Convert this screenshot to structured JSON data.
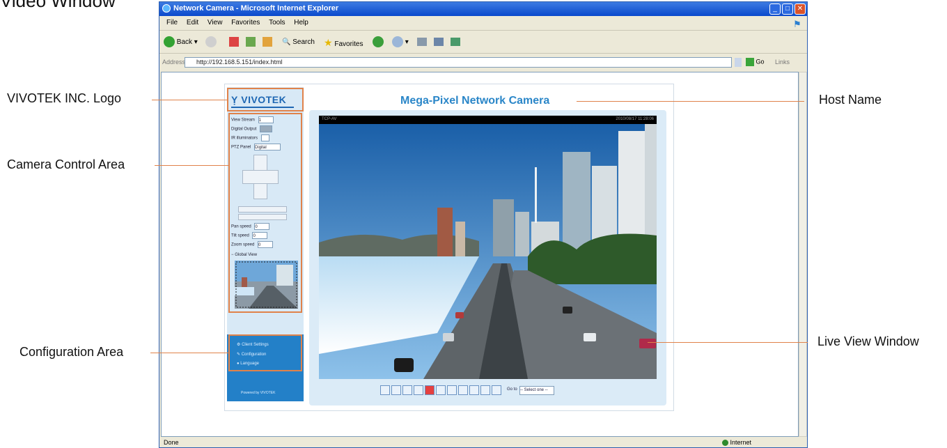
{
  "page_heading": "Video Window",
  "browser": {
    "title": "Network Camera - Microsoft Internet Explorer",
    "menu": [
      "File",
      "Edit",
      "View",
      "Favorites",
      "Tools",
      "Help"
    ],
    "toolbar": {
      "back": "Back",
      "search": "Search",
      "favorites": "Favorites"
    },
    "address_label": "Address",
    "address_url": "http://192.168.5.151/index.html",
    "go_label": "Go",
    "links_label": "Links",
    "status_left": "Done",
    "status_right": "Internet"
  },
  "camera_page": {
    "host_name": "Mega-Pixel Network Camera",
    "logo_text": "VIVOTEK",
    "controls": {
      "view_stream": "View Stream",
      "view_stream_value": "1",
      "digital_output": "Digital Output",
      "ir_illuminators": "IR illuminators",
      "ptz_panel": "PTZ Panel",
      "ptz_panel_value": "Digital",
      "pan_speed": "Pan speed",
      "pan_speed_value": "0",
      "tilt_speed": "Tilt speed",
      "tilt_speed_value": "0",
      "zoom_speed": "Zoom speed",
      "zoom_speed_value": "0",
      "global_view": "Global View"
    },
    "config": {
      "client_settings": "Client Settings",
      "configuration": "Configuration",
      "language": "Language",
      "powered_by": "Powered by VIVOTEK"
    },
    "live": {
      "caption_left": "TCP-AV",
      "caption_right": "2010/08/17 11:28:06",
      "goto_label": "Go to",
      "goto_select": "-- Select one --"
    }
  },
  "callouts": {
    "logo": "VIVOTEK INC. Logo",
    "camera_control": "Camera Control Area",
    "configuration": "Configuration Area",
    "host_name": "Host Name",
    "live_view": "Live View Window"
  },
  "colors": {
    "callout_line": "#e0824a",
    "panel_blue": "#2380c8",
    "host_name_blue": "#2a86c8"
  }
}
